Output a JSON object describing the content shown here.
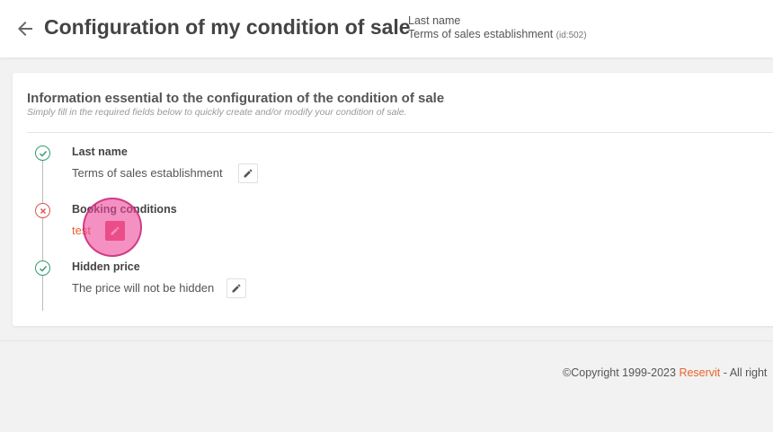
{
  "header": {
    "title": "Configuration of my condition of sale",
    "meta_label": "Last name",
    "meta_value": "Terms of sales establishment",
    "meta_id": "(id:502)"
  },
  "card": {
    "title": "Information essential to the configuration of the condition of sale",
    "subtitle": "Simply fill in the required fields below to quickly create and/or modify your condition of sale."
  },
  "steps": [
    {
      "label": "Last name",
      "value": "Terms of sales establishment",
      "status": "ok"
    },
    {
      "label": "Booking conditions",
      "value": "test",
      "status": "error"
    },
    {
      "label": "Hidden price",
      "value": "The price will not be hidden",
      "status": "ok"
    }
  ],
  "footer": {
    "copyright": "©Copyright 1999-2023 ",
    "brand": "Reservit",
    "rest": " - All right"
  },
  "colors": {
    "ok": "#2e9d6c",
    "error": "#d9534f",
    "brand": "#e8632c"
  },
  "icons": {
    "back": "arrow-left-icon",
    "ok": "check-circle-icon",
    "error": "x-circle-icon",
    "edit": "pencil-icon"
  }
}
